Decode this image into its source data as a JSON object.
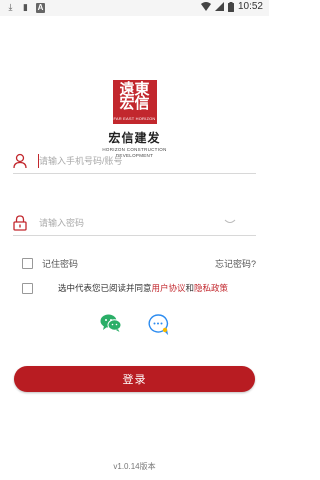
{
  "status_bar": {
    "time": "10:52"
  },
  "logo": {
    "calligraphy": "遠東宏信",
    "badge_en": "FAR EAST HORIZON",
    "name": "宏信建发",
    "name_en_line1": "HORIZON CONSTRUCTION",
    "name_en_line2": "DEVELOPMENT"
  },
  "login_form": {
    "account_placeholder": "请输入手机号码/账号",
    "account_value": "",
    "password_placeholder": "请输入密码",
    "password_value": "",
    "remember_label": "记住密码",
    "forgot_label": "忘记密码?",
    "agree_prefix": "选中代表您已阅读并同意",
    "user_agreement": "用户协议",
    "agree_and": "和",
    "privacy_policy": "隐私政策",
    "submit_label": "登录"
  },
  "social_login": {
    "wechat_icon": "wechat-icon",
    "chat_icon": "chat-bubble-icon"
  },
  "footer": {
    "version": "v1.0.14版本"
  },
  "colors": {
    "brand_red": "#b81c22",
    "link_red": "#c2272d",
    "wechat_green": "#2aae67",
    "chat_blue": "#2d8cf0"
  }
}
